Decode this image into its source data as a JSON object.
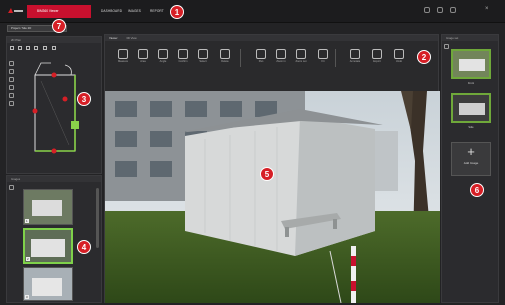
{
  "topbar": {
    "app_tab": "BIM360 Viewer",
    "menus": [
      "DASHBOARD",
      "IMAGES",
      "REPORT"
    ]
  },
  "path_field": "Project / Site 2D",
  "left_map": {
    "title": "2D Plan"
  },
  "left_pictures": {
    "title": "Images",
    "pic_labels": [
      "1",
      "2",
      "3"
    ]
  },
  "center": {
    "title": "Viewer",
    "tabs": [
      "Viewer",
      "3D View"
    ],
    "tools": [
      {
        "label": "Measure",
        "icon": "pencil-icon"
      },
      {
        "label": "Area",
        "icon": "square-icon"
      },
      {
        "label": "Angle",
        "icon": "angle-icon"
      },
      {
        "label": "Confirm",
        "icon": "check-icon"
      },
      {
        "label": "Select",
        "icon": "select-icon"
      },
      {
        "label": "Delete",
        "icon": "trash-icon"
      },
      {
        "label": "Pan",
        "icon": "hand-icon"
      },
      {
        "label": "Zoom in",
        "icon": "zoom-in-icon"
      },
      {
        "label": "Zoom out",
        "icon": "zoom-out-icon"
      },
      {
        "label": "Fit",
        "icon": "fit-icon"
      },
      {
        "label": "Annotate",
        "icon": "annotate-icon"
      },
      {
        "label": "Export",
        "icon": "export-icon"
      },
      {
        "label": "Undo",
        "icon": "undo-icon"
      }
    ]
  },
  "right": {
    "title": "Image set",
    "thumb_labels": [
      "Front",
      "Side"
    ],
    "add_label": "Add Image"
  },
  "markers": [
    "1",
    "2",
    "3",
    "4",
    "5",
    "6",
    "7"
  ],
  "colors": {
    "accent": "#c8102e",
    "selection": "#7fd14a",
    "marker": "#d61f26"
  }
}
